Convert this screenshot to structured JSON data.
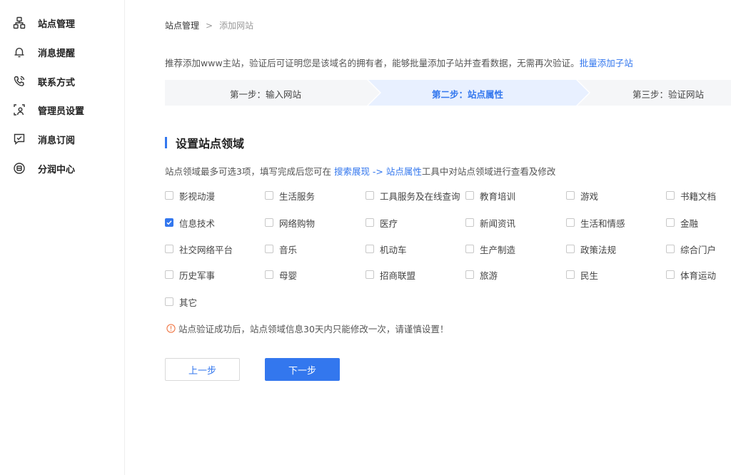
{
  "sidebar": {
    "items": [
      {
        "label": "站点管理",
        "icon": "site-management-icon"
      },
      {
        "label": "消息提醒",
        "icon": "bell-icon"
      },
      {
        "label": "联系方式",
        "icon": "phone-icon"
      },
      {
        "label": "管理员设置",
        "icon": "admin-user-icon"
      },
      {
        "label": "消息订阅",
        "icon": "message-subscribe-icon"
      },
      {
        "label": "分润中心",
        "icon": "revenue-share-icon"
      }
    ]
  },
  "breadcrumb": {
    "root": "站点管理",
    "separator": ">",
    "current": "添加网站"
  },
  "intro": {
    "text": "推荐添加www主站，验证后可证明您是该域名的拥有者，能够批量添加子站并查看数据，无需再次验证。",
    "link": "批量添加子站"
  },
  "steps": [
    {
      "label": "第一步：输入网站",
      "active": false
    },
    {
      "label": "第二步：站点属性",
      "active": true
    },
    {
      "label": "第三步：验证网站",
      "active": false
    }
  ],
  "section": {
    "title": "设置站点领域",
    "desc_prefix": "站点领域最多可选3项，填写完成后您可在 ",
    "desc_link": "搜索展现 -> 站点属性",
    "desc_suffix": "工具中对站点领域进行查看及修改"
  },
  "domains": [
    {
      "label": "影视动漫",
      "checked": false
    },
    {
      "label": "生活服务",
      "checked": false
    },
    {
      "label": "工具服务及在线查询",
      "checked": false
    },
    {
      "label": "教育培训",
      "checked": false
    },
    {
      "label": "游戏",
      "checked": false
    },
    {
      "label": "书籍文档",
      "checked": false
    },
    {
      "label": "信息技术",
      "checked": true
    },
    {
      "label": "网络购物",
      "checked": false
    },
    {
      "label": "医疗",
      "checked": false
    },
    {
      "label": "新闻资讯",
      "checked": false
    },
    {
      "label": "生活和情感",
      "checked": false
    },
    {
      "label": "金融",
      "checked": false
    },
    {
      "label": "社交网络平台",
      "checked": false
    },
    {
      "label": "音乐",
      "checked": false
    },
    {
      "label": "机动车",
      "checked": false
    },
    {
      "label": "生产制造",
      "checked": false
    },
    {
      "label": "政策法规",
      "checked": false
    },
    {
      "label": "综合门户",
      "checked": false
    },
    {
      "label": "历史军事",
      "checked": false
    },
    {
      "label": "母婴",
      "checked": false
    },
    {
      "label": "招商联盟",
      "checked": false
    },
    {
      "label": "旅游",
      "checked": false
    },
    {
      "label": "民生",
      "checked": false
    },
    {
      "label": "体育运动",
      "checked": false
    },
    {
      "label": "其它",
      "checked": false
    }
  ],
  "warning": {
    "icon": "warning-circle-icon",
    "text": "站点验证成功后，站点领域信息30天内只能修改一次，请谨慎设置！"
  },
  "buttons": {
    "prev": "上一步",
    "next": "下一步"
  },
  "colors": {
    "accent": "#3377ee",
    "step_bg": "#f5f6f8",
    "step_active_bg": "#e8f0ff",
    "warning": "#f07a4a"
  }
}
